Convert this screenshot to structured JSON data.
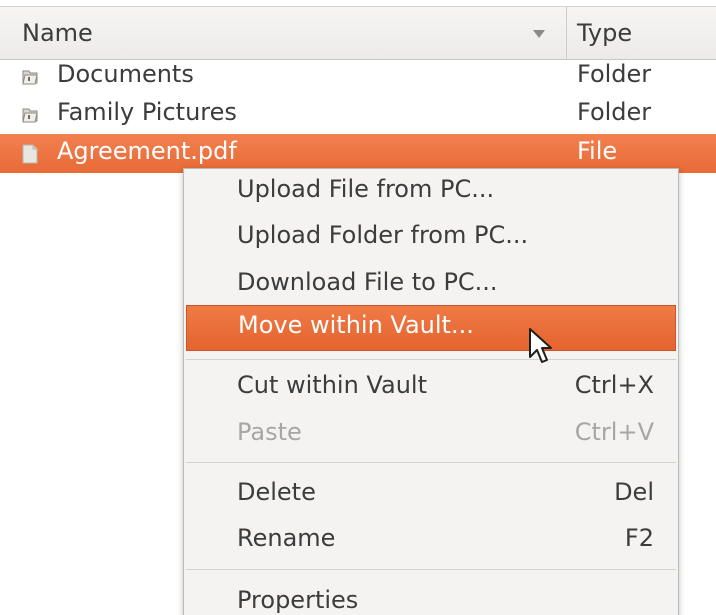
{
  "header": {
    "name_label": "Name",
    "type_label": "Type"
  },
  "rows": [
    {
      "name": "Documents",
      "type": "Folder",
      "icon": "folder-icon"
    },
    {
      "name": "Family Pictures",
      "type": "Folder",
      "icon": "folder-icon"
    },
    {
      "name": "Agreement.pdf",
      "type": "File",
      "icon": "file-icon",
      "selected": true
    }
  ],
  "context_menu": {
    "items": [
      {
        "label": "Upload File from PC...",
        "accel": ""
      },
      {
        "label": "Upload Folder from PC...",
        "accel": ""
      },
      {
        "label": "Download File to PC...",
        "accel": ""
      },
      {
        "label": "Move within Vault...",
        "accel": "",
        "highlighted": true
      },
      {
        "label": "Cut within Vault",
        "accel": "Ctrl+X"
      },
      {
        "label": "Paste",
        "accel": "Ctrl+V",
        "disabled": true
      },
      {
        "label": "Delete",
        "accel": "Del"
      },
      {
        "label": "Rename",
        "accel": "F2"
      },
      {
        "label": "Properties",
        "accel": ""
      }
    ]
  },
  "colors": {
    "selection": "#e86a37",
    "menu_bg": "#f4f3f2",
    "disabled_text": "#a8a6a3"
  }
}
